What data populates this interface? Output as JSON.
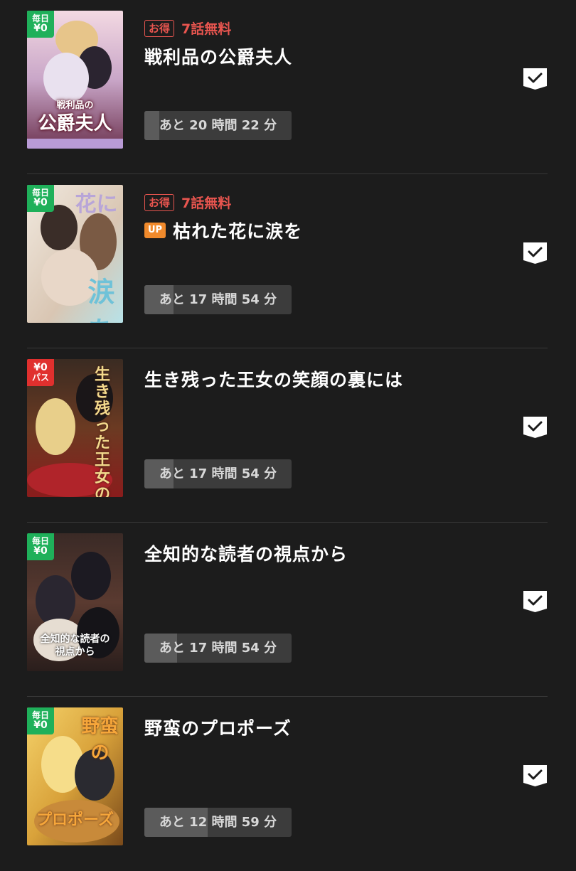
{
  "items": [
    {
      "badge": {
        "line1": "毎日",
        "line2": "¥0",
        "color": "#1fb05a"
      },
      "cover_title": "公爵夫人",
      "cover_subtitle": "戦利品の",
      "promo_tag": "お得",
      "promo_text": "7話無料",
      "up_label": "",
      "title": "戦利品の公爵夫人",
      "timer": "あと 20 時間 22 分",
      "progress": 0.1,
      "check_icon": "bookmark-check-icon"
    },
    {
      "badge": {
        "line1": "毎日",
        "line2": "¥0",
        "color": "#1fb05a"
      },
      "cover_title": "涙を",
      "cover_subtitle": "花に",
      "promo_tag": "お得",
      "promo_text": "7話無料",
      "up_label": "UP",
      "title": "枯れた花に涙を",
      "timer": "あと 17 時間 54 分",
      "progress": 0.2,
      "check_icon": "bookmark-check-icon"
    },
    {
      "badge": {
        "line1": "¥0",
        "line2": "パス",
        "color": "#e0302e"
      },
      "cover_title": "生き残った王女の笑顔の裏には",
      "cover_subtitle": "",
      "promo_tag": "",
      "promo_text": "",
      "up_label": "",
      "title": "生き残った王女の笑顔の裏には",
      "timer": "あと 17 時間 54 分",
      "progress": 0.2,
      "check_icon": "bookmark-check-icon"
    },
    {
      "badge": {
        "line1": "毎日",
        "line2": "¥0",
        "color": "#1fb05a"
      },
      "cover_title": "全知的な読者の視点から",
      "cover_subtitle": "",
      "promo_tag": "",
      "promo_text": "",
      "up_label": "",
      "title": "全知的な読者の視点から",
      "timer": "あと 17 時間 54 分",
      "progress": 0.22,
      "check_icon": "bookmark-check-icon"
    },
    {
      "badge": {
        "line1": "毎日",
        "line2": "¥0",
        "color": "#1fb05a"
      },
      "cover_title": "野蛮の",
      "cover_subtitle": "プロポーズ",
      "promo_tag": "",
      "promo_text": "",
      "up_label": "",
      "title": "野蛮のプロポーズ",
      "timer": "あと 12 時間 59 分",
      "progress": 0.43,
      "check_icon": "bookmark-check-icon"
    }
  ]
}
